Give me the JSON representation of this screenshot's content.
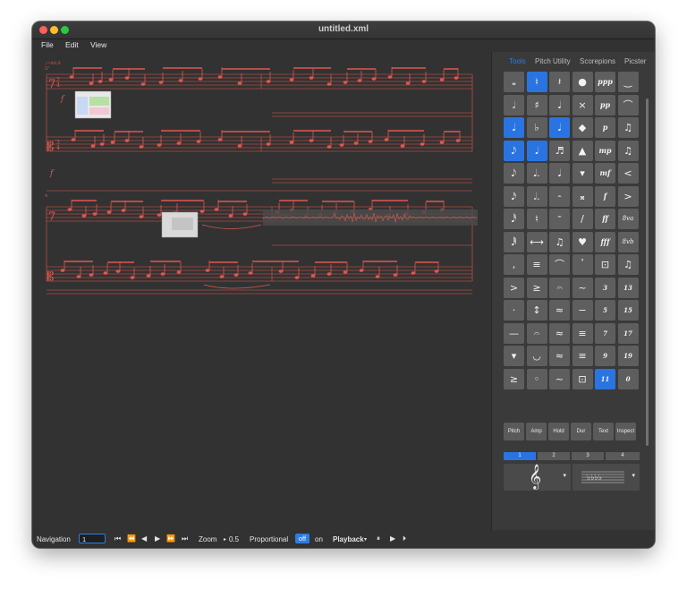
{
  "window": {
    "title": "untitled.xml"
  },
  "menu": {
    "file": "File",
    "edit": "Edit",
    "view": "View"
  },
  "score": {
    "tempo_marking": "♩=60.0",
    "page_marker": "5\"",
    "dynamic_1": "f",
    "dynamic_2": "f",
    "measure_number": "4"
  },
  "panel": {
    "tabs": [
      "Tools",
      "Pitch Utility",
      "Scorepions",
      "Picster"
    ],
    "active_tab": "Tools",
    "grid_labels": [
      "ppp",
      "pp",
      "p",
      "mp",
      "mf",
      "f",
      "ff",
      "fff",
      "8va",
      "8vb",
      "3",
      "13",
      "5",
      "15",
      "7",
      "17",
      "9",
      "19",
      "11",
      "0"
    ],
    "mode_buttons": [
      "Pitch",
      "Amp",
      "Hold",
      "Dur",
      "Text",
      "Inspect"
    ],
    "number_tabs": [
      "1",
      "2",
      "3",
      "4"
    ]
  },
  "bottom": {
    "navigation_label": "Navigation",
    "navigation_value": "1",
    "zoom_label": "Zoom",
    "zoom_value": "0.5",
    "proportional_label": "Proportional",
    "proportional_off": "off",
    "proportional_on": "on",
    "playback_label": "Playback"
  },
  "colors": {
    "accent": "#2a74e2",
    "notation": "#e0574f",
    "bg": "#323232"
  }
}
